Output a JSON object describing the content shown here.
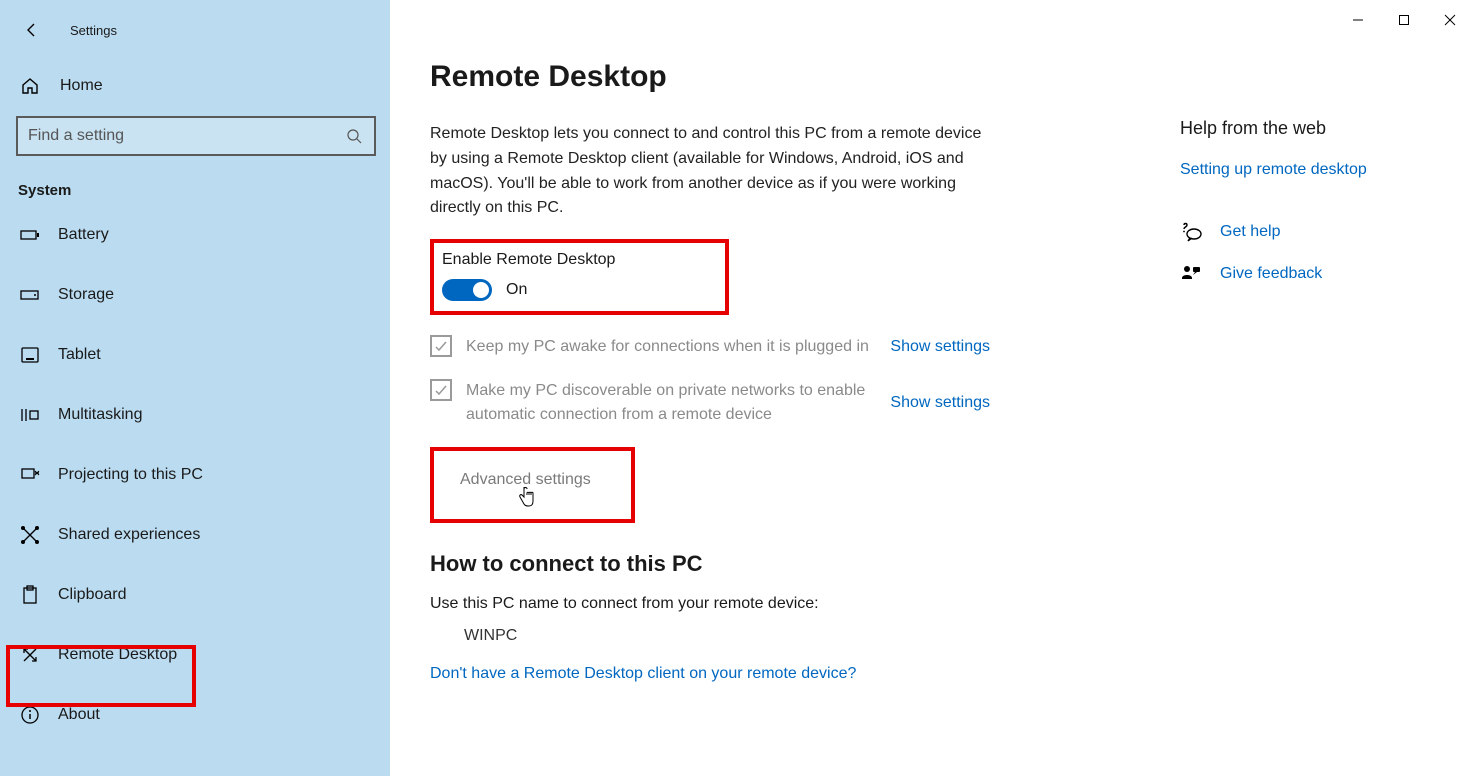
{
  "app_title": "Settings",
  "home_label": "Home",
  "search_placeholder": "Find a setting",
  "category_label": "System",
  "sidebar": {
    "items": [
      {
        "label": "Battery"
      },
      {
        "label": "Storage"
      },
      {
        "label": "Tablet"
      },
      {
        "label": "Multitasking"
      },
      {
        "label": "Projecting to this PC"
      },
      {
        "label": "Shared experiences"
      },
      {
        "label": "Clipboard"
      },
      {
        "label": "Remote Desktop"
      },
      {
        "label": "About"
      }
    ]
  },
  "main": {
    "title": "Remote Desktop",
    "description": "Remote Desktop lets you connect to and control this PC from a remote device by using a Remote Desktop client (available for Windows, Android, iOS and macOS). You'll be able to work from another device as if you were working directly on this PC.",
    "enable_label": "Enable Remote Desktop",
    "toggle_state": "On",
    "option1": "Keep my PC awake for connections when it is plugged in",
    "option2": "Make my PC discoverable on private networks to enable automatic connection from a remote device",
    "show_settings": "Show settings",
    "advanced_label": "Advanced settings",
    "connect_heading": "How to connect to this PC",
    "connect_desc": "Use this PC name to connect from your remote device:",
    "pc_name": "WINPC",
    "client_link": "Don't have a Remote Desktop client on your remote device?"
  },
  "help": {
    "title": "Help from the web",
    "setup_link": "Setting up remote desktop",
    "get_help": "Get help",
    "give_feedback": "Give feedback"
  }
}
